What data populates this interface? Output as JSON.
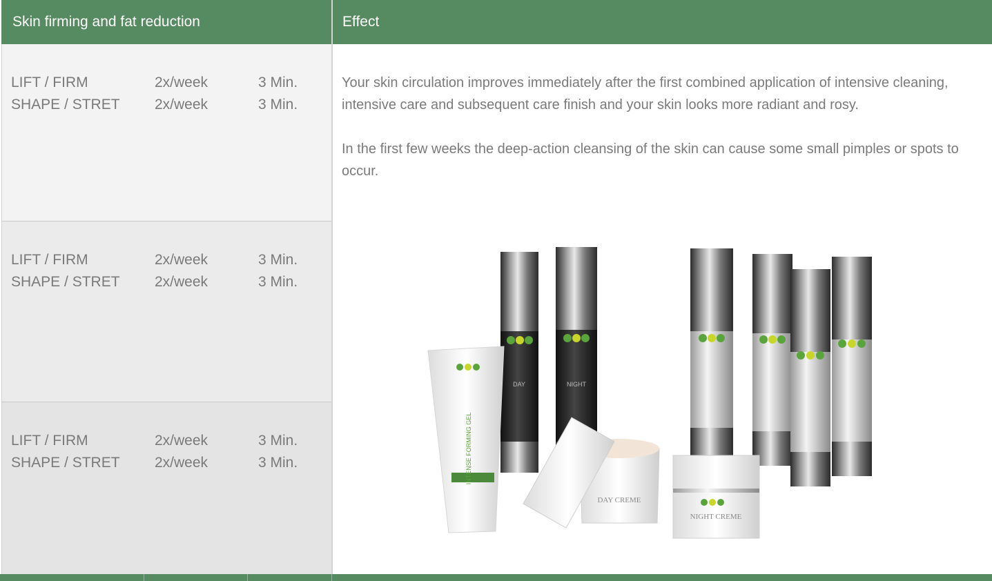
{
  "header": {
    "left_title": "Skin firming and fat reduction",
    "right_title": "Effect"
  },
  "treatment_blocks": [
    {
      "rows": [
        {
          "name": "LIFT / FIRM",
          "frequency": "2x/week",
          "duration": "3 Min."
        },
        {
          "name": "SHAPE / STRET",
          "frequency": "2x/week",
          "duration": "3 Min."
        }
      ]
    },
    {
      "rows": [
        {
          "name": "LIFT / FIRM",
          "frequency": "2x/week",
          "duration": "3 Min."
        },
        {
          "name": "SHAPE / STRET",
          "frequency": "2x/week",
          "duration": "3 Min."
        }
      ]
    },
    {
      "rows": [
        {
          "name": "LIFT / FIRM",
          "frequency": "2x/week",
          "duration": "3 Min."
        },
        {
          "name": "SHAPE / STRET",
          "frequency": "2x/week",
          "duration": "3 Min."
        }
      ]
    }
  ],
  "effect": {
    "paragraph_1": "Your skin circulation improves immediately after the first combined application of intensive cleaning, intensive care and subsequent care finish and your skin looks more radiant and rosy.",
    "paragraph_2": "In the first few weeks the deep-action cleansing of the skin can cause some small pimples or spots to occur."
  },
  "product_image": {
    "alt": "product-lineup-photo",
    "tube_label": "INTENSE FORMING GEL",
    "jar_1_label": "DAY CREME",
    "jar_2_label": "NIGHT CREME",
    "bottle_labels": [
      "DAY",
      "NIGHT"
    ]
  },
  "colors": {
    "header_green": "#568b61",
    "text_gray": "#7a7a7a",
    "logo_green": "#5aa43c",
    "logo_yellow": "#c8d62a"
  }
}
